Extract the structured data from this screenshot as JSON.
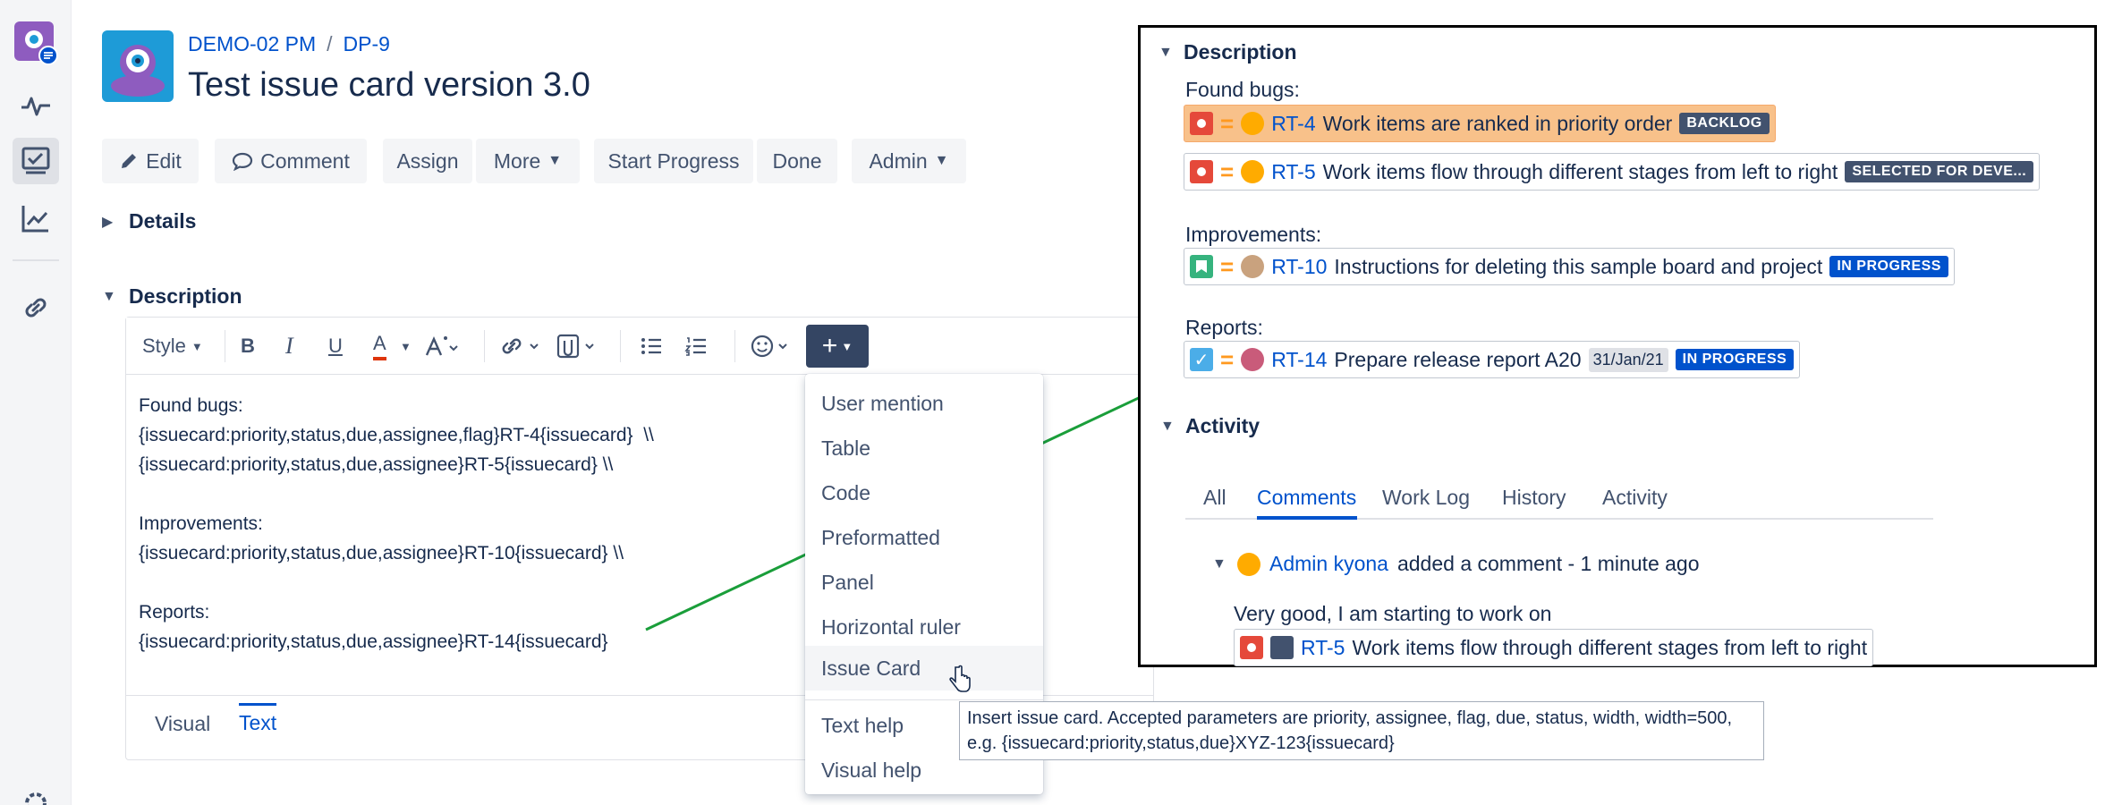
{
  "project": {
    "name": "DEMO-02 PM",
    "issue_key": "DP-9",
    "title": "Test issue card version 3.0"
  },
  "toolbar": {
    "edit": "Edit",
    "comment": "Comment",
    "assign": "Assign",
    "more": "More",
    "start_progress": "Start Progress",
    "done": "Done",
    "admin": "Admin"
  },
  "sections": {
    "details": "Details",
    "description": "Description",
    "activity": "Activity"
  },
  "editor": {
    "style_label": "Style",
    "content": "Found bugs:\n{issuecard:priority,status,due,assignee,flag}RT-4{issuecard}  \\\\\n{issuecard:priority,status,due,assignee}RT-5{issuecard} \\\\\n\nImprovements:\n{issuecard:priority,status,due,assignee}RT-10{issuecard} \\\\\n\nReports:\n{issuecard:priority,status,due,assignee}RT-14{issuecard}",
    "tabs": {
      "visual": "Visual",
      "text": "Text"
    }
  },
  "insert_menu": {
    "items": [
      "User mention",
      "Table",
      "Code",
      "Preformatted",
      "Panel",
      "Horizontal ruler",
      "Issue Card"
    ],
    "help": [
      "Text help",
      "Visual help"
    ],
    "hovered": "Issue Card"
  },
  "tooltip": "Insert issue card. Accepted parameters are priority, assignee, flag, due, status, width, width=500, e.g. {issuecard:priority,status,due}XYZ-123{issuecard}",
  "preview": {
    "description_heading": "Description",
    "groups": {
      "bugs": "Found bugs:",
      "improvements": "Improvements:",
      "reports": "Reports:"
    },
    "cards": [
      {
        "key": "RT-4",
        "summary": "Work items are ranked in priority order",
        "status": "BACKLOG"
      },
      {
        "key": "RT-5",
        "summary": "Work items flow through different stages from left to right",
        "status": "SELECTED FOR DEVE..."
      },
      {
        "key": "RT-10",
        "summary": "Instructions for deleting this sample board and project",
        "status": "IN PROGRESS"
      },
      {
        "key": "RT-14",
        "summary": "Prepare release report A20",
        "due": "31/Jan/21",
        "status": "IN PROGRESS"
      }
    ],
    "activity_heading": "Activity",
    "activity_tabs": [
      "All",
      "Comments",
      "Work Log",
      "History",
      "Activity"
    ],
    "comment": {
      "author": "Admin kyona",
      "meta": "added a comment - 1 minute ago",
      "body": "Very good, I am starting to work on",
      "card_key": "RT-5",
      "card_summary": "Work items flow through different stages from left to right"
    }
  },
  "colors": {
    "link": "#0052cc",
    "annotation_line": "#1a9e3a",
    "highlight_card": "#f8c18a"
  }
}
